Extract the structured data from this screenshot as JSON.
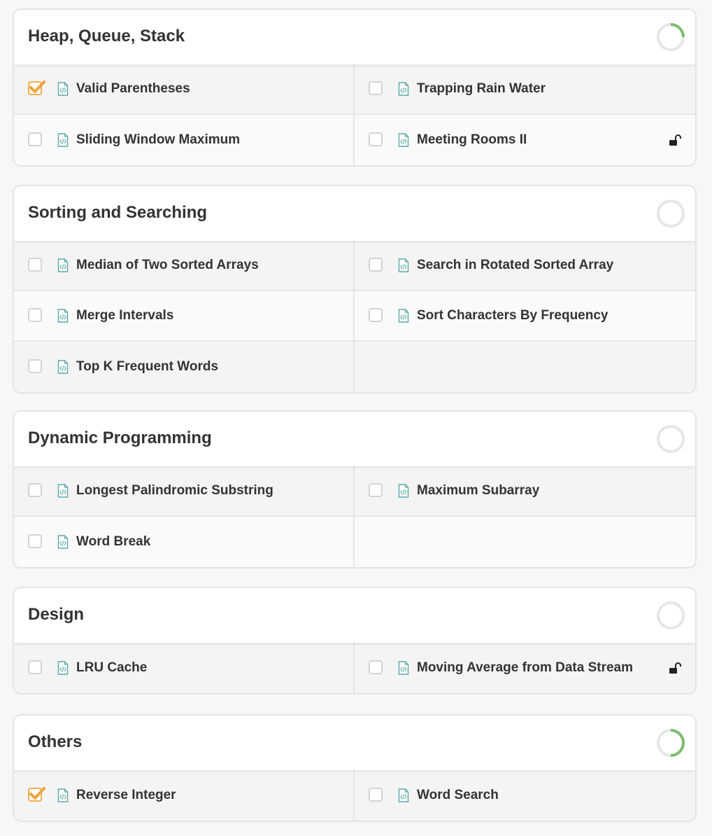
{
  "sections": [
    {
      "title": "Heap, Queue, Stack",
      "progress": 0.25,
      "rows": [
        [
          {
            "label": "Valid Parentheses",
            "checked": true,
            "locked": false
          },
          {
            "label": "Trapping Rain Water",
            "checked": false,
            "locked": false
          }
        ],
        [
          {
            "label": "Sliding Window Maximum",
            "checked": false,
            "locked": false
          },
          {
            "label": "Meeting Rooms II",
            "checked": false,
            "locked": true
          }
        ]
      ]
    },
    {
      "title": "Sorting and Searching",
      "progress": 0,
      "rows": [
        [
          {
            "label": "Median of Two Sorted Arrays",
            "checked": false,
            "locked": false
          },
          {
            "label": "Search in Rotated Sorted Array",
            "checked": false,
            "locked": false
          }
        ],
        [
          {
            "label": "Merge Intervals",
            "checked": false,
            "locked": false
          },
          {
            "label": "Sort Characters By Frequency",
            "checked": false,
            "locked": false
          }
        ],
        [
          {
            "label": "Top K Frequent Words",
            "checked": false,
            "locked": false
          },
          null
        ]
      ]
    },
    {
      "title": "Dynamic Programming",
      "progress": 0,
      "rows": [
        [
          {
            "label": "Longest Palindromic Substring",
            "checked": false,
            "locked": false
          },
          {
            "label": "Maximum Subarray",
            "checked": false,
            "locked": false
          }
        ],
        [
          {
            "label": "Word Break",
            "checked": false,
            "locked": false
          },
          null
        ]
      ]
    },
    {
      "title": "Design",
      "progress": 0,
      "rows": [
        [
          {
            "label": "LRU Cache",
            "checked": false,
            "locked": false
          },
          {
            "label": "Moving Average from Data Stream",
            "checked": false,
            "locked": true
          }
        ]
      ]
    },
    {
      "title": "Others",
      "progress": 0.5,
      "rows": [
        [
          {
            "label": "Reverse Integer",
            "checked": true,
            "locked": false
          },
          {
            "label": "Word Search",
            "checked": false,
            "locked": false
          }
        ]
      ]
    }
  ],
  "colors": {
    "progress": "#7dbb6f",
    "ring_track": "#e6e6e6",
    "check": "#f0a23b",
    "doc_icon": "#5aa9a3"
  },
  "icons": {
    "checkbox": "checkbox-icon",
    "problem": "code-file-icon",
    "lock": "unlock-icon",
    "progress": "progress-ring-icon"
  }
}
